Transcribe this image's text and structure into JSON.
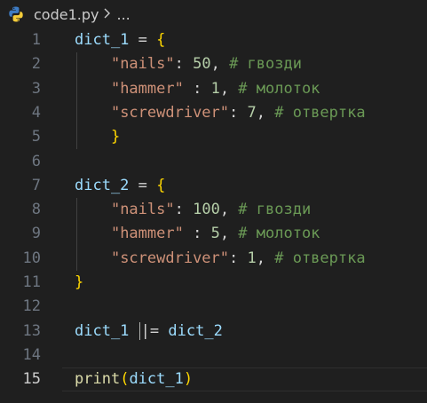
{
  "breadcrumb": {
    "file_name": "code1.py",
    "separator": ">",
    "more": "...",
    "icon": "python-icon"
  },
  "editor": {
    "active_line": 15,
    "lines": [
      {
        "number": "1",
        "tokens": [
          [
            "var",
            "dict_1"
          ],
          [
            "op",
            " = "
          ],
          [
            "br1",
            "{"
          ]
        ]
      },
      {
        "number": "2",
        "tokens": [
          [
            "op",
            "    "
          ],
          [
            "str",
            "\"nails\""
          ],
          [
            "op",
            ": "
          ],
          [
            "num",
            "50"
          ],
          [
            "op",
            ", "
          ],
          [
            "com",
            "# гвозди"
          ]
        ]
      },
      {
        "number": "3",
        "tokens": [
          [
            "op",
            "    "
          ],
          [
            "str",
            "\"hammer\""
          ],
          [
            "op",
            " : "
          ],
          [
            "num",
            "1"
          ],
          [
            "op",
            ", "
          ],
          [
            "com",
            "# молоток"
          ]
        ]
      },
      {
        "number": "4",
        "tokens": [
          [
            "op",
            "    "
          ],
          [
            "str",
            "\"screwdriver\""
          ],
          [
            "op",
            ": "
          ],
          [
            "num",
            "7"
          ],
          [
            "op",
            ", "
          ],
          [
            "com",
            "# отвертка"
          ]
        ]
      },
      {
        "number": "5",
        "tokens": [
          [
            "op",
            "    "
          ],
          [
            "br1",
            "}"
          ]
        ]
      },
      {
        "number": "6",
        "tokens": []
      },
      {
        "number": "7",
        "tokens": [
          [
            "var",
            "dict_2"
          ],
          [
            "op",
            " = "
          ],
          [
            "br1",
            "{"
          ]
        ]
      },
      {
        "number": "8",
        "tokens": [
          [
            "op",
            "    "
          ],
          [
            "str",
            "\"nails\""
          ],
          [
            "op",
            ": "
          ],
          [
            "num",
            "100"
          ],
          [
            "op",
            ", "
          ],
          [
            "com",
            "# гвозди"
          ]
        ]
      },
      {
        "number": "9",
        "tokens": [
          [
            "op",
            "    "
          ],
          [
            "str",
            "\"hammer\""
          ],
          [
            "op",
            " : "
          ],
          [
            "num",
            "5"
          ],
          [
            "op",
            ", "
          ],
          [
            "com",
            "# молоток"
          ]
        ]
      },
      {
        "number": "10",
        "tokens": [
          [
            "op",
            "    "
          ],
          [
            "str",
            "\"screwdriver\""
          ],
          [
            "op",
            ": "
          ],
          [
            "num",
            "1"
          ],
          [
            "op",
            ", "
          ],
          [
            "com",
            "# отвертка"
          ]
        ]
      },
      {
        "number": "11",
        "tokens": [
          [
            "br1",
            "}"
          ]
        ]
      },
      {
        "number": "12",
        "tokens": []
      },
      {
        "number": "13",
        "tokens": [
          [
            "var",
            "dict_1"
          ],
          [
            "op",
            " "
          ],
          [
            "cursor",
            ""
          ],
          [
            "op",
            "|= "
          ],
          [
            "var",
            "dict_2"
          ]
        ]
      },
      {
        "number": "14",
        "tokens": []
      },
      {
        "number": "15",
        "tokens": [
          [
            "fn",
            "print"
          ],
          [
            "br1",
            "("
          ],
          [
            "var",
            "dict_1"
          ],
          [
            "br1",
            ")"
          ]
        ]
      }
    ]
  },
  "colors": {
    "background": "#1f1f1f",
    "variable": "#9cdcfe",
    "string": "#ce9178",
    "number": "#b5cea8",
    "comment": "#6a9955",
    "function": "#dcdcaa",
    "bracket": "#ffd700"
  }
}
